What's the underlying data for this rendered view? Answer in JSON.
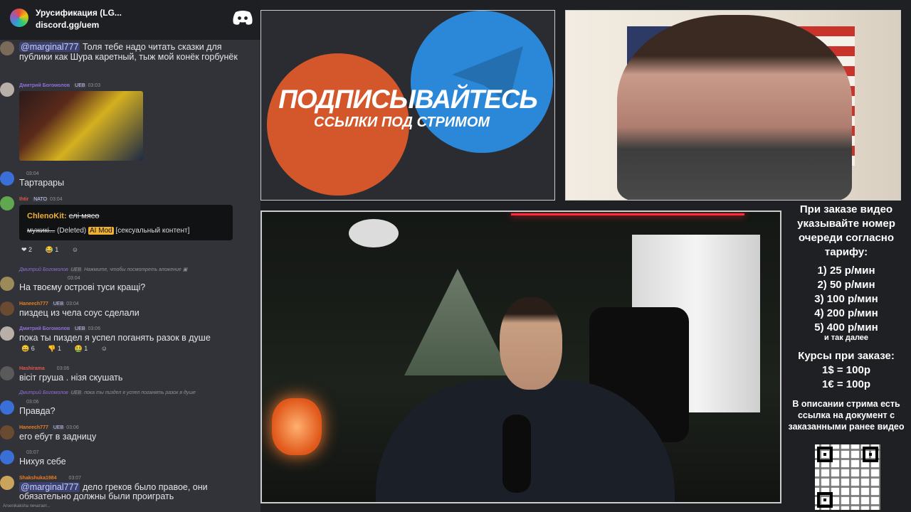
{
  "chat": {
    "server_name": "Урусификация (LG...",
    "server_link": "discord.gg/uem",
    "messages": [
      {
        "mention": "@marginal777",
        "text_a": " Толя тебе надо читать сказки для",
        "text_b": "публики как Шура каретный, тыж мой конёк горбунёк"
      },
      {
        "nick": "Дмитрий Богомолов",
        "badge": "UEB",
        "time": "03:03",
        "image": "stream screenshot"
      },
      {
        "time": "03:04",
        "text": "Тартарары"
      },
      {
        "nick": "Ihtir",
        "badge": "NATO",
        "time": "03:04",
        "deleted_author": "ChlenoKit:",
        "deleted_struck": "єлі мясо",
        "deleted_struck2": "мужикі...",
        "deleted_tag": "(Deleted)",
        "deleted_role": "AI Mod",
        "deleted_reason": "[сексуальный контент]",
        "reactions": [
          "2",
          "1",
          ""
        ]
      },
      {
        "reply_nick": "Дмитрий Богомолов",
        "reply_badge": "UEB",
        "reply_text": "Нажмите, чтобы посмотреть вложение",
        "time": "03:04",
        "text": "На твоєму острові туси кращі?"
      },
      {
        "nick": "Haneech777",
        "badge": "UEB",
        "time": "03:04",
        "text": "пиздец из чела соус сделали"
      },
      {
        "nick": "Дмитрий Богомолов",
        "badge": "UEB",
        "time": "03:06",
        "text": "пока ты пиздел  я успел поганять разок в душе",
        "reactions": [
          "6",
          "1",
          "1",
          ""
        ]
      },
      {
        "nick": "Hashirama",
        "time": "03:06",
        "text": "вісіт груша . нізя скушать"
      },
      {
        "reply_nick": "Дмитрий Богомолов",
        "reply_badge": "UEB",
        "reply_text": "пока ты пиздел  я успел поганять разок в душе",
        "time": "03:06",
        "text": "Правда?"
      },
      {
        "nick": "Haneech777",
        "badge": "UEB",
        "time": "03:06",
        "text": "его ебут в задницу"
      },
      {
        "time": "03:07",
        "text": "Нихуя себе"
      },
      {
        "nick": "Shakshuka1984",
        "time": "03:07",
        "mention": "@marginal777",
        "text_a": " дело греков было правое, они",
        "text_b": "обязательно должны были проиграть"
      }
    ],
    "typing": "Arsenikaksha печатает..."
  },
  "promo": {
    "headline": "ПОДПИСЫВАЙТЕСЬ",
    "subline": "ССЫЛКИ ПОД СТРИМОМ"
  },
  "info": {
    "intro": "При заказе видео указывайте номер очереди согласно тарифу:",
    "rates": [
      "1) 25 р/мин",
      "2) 50 р/мин",
      "3) 100 р/мин",
      "4) 200 р/мин",
      "5) 400 р/мин"
    ],
    "more": "и так далее",
    "courses_title": "Курсы при заказе:",
    "courses": [
      "1$ = 100р",
      "1€ = 100р"
    ],
    "description": "В описании стрима есть ссылка на документ с заказанными ранее видео"
  },
  "colors": {
    "accent": "#5865f2",
    "chat_bg": "#313338",
    "promo_orange": "#d4572b",
    "promo_blue": "#2b88d8"
  }
}
